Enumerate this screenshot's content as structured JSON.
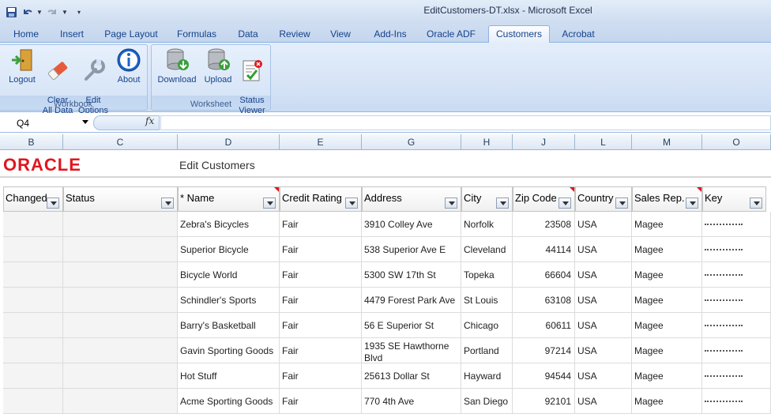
{
  "window": {
    "title": "EditCustomers-DT.xlsx - Microsoft Excel"
  },
  "ribbon_tabs": [
    {
      "label": "Home"
    },
    {
      "label": "Insert"
    },
    {
      "label": "Page Layout"
    },
    {
      "label": "Formulas"
    },
    {
      "label": "Data"
    },
    {
      "label": "Review"
    },
    {
      "label": "View"
    },
    {
      "label": "Add-Ins"
    },
    {
      "label": "Oracle ADF"
    },
    {
      "label": "Customers"
    },
    {
      "label": "Acrobat"
    }
  ],
  "active_tab": "Customers",
  "groups": {
    "workbook": {
      "label": "Workbook",
      "buttons": [
        {
          "label": "Logout",
          "icon": "logout-door-icon"
        },
        {
          "label": "Clear\nAll Data",
          "icon": "eraser-icon"
        },
        {
          "label": "Edit\nOptions",
          "icon": "wrench-icon"
        },
        {
          "label": "About",
          "icon": "info-icon"
        }
      ]
    },
    "worksheet": {
      "label": "Worksheet",
      "buttons": [
        {
          "label": "Download",
          "icon": "database-download-icon"
        },
        {
          "label": "Upload",
          "icon": "database-upload-icon"
        },
        {
          "label": "Status\nViewer",
          "icon": "status-viewer-icon"
        }
      ]
    }
  },
  "formula_bar": {
    "name_box": "Q4",
    "fx": "fx",
    "formula": ""
  },
  "columns": [
    "B",
    "C",
    "D",
    "E",
    "G",
    "H",
    "J",
    "L",
    "M",
    "O"
  ],
  "sheet": {
    "logo_text": "ORACLE",
    "title": "Edit Customers",
    "headers": [
      "Changed",
      "Status",
      "* Name",
      "Credit Rating",
      "Address",
      "City",
      "Zip Code",
      "Country",
      "Sales Rep.",
      "Key"
    ],
    "rows": [
      [
        "",
        "",
        "Zebra's Bicycles",
        "Fair",
        "3910 Colley Ave",
        "Norfolk",
        "23508",
        "USA",
        "Magee",
        ""
      ],
      [
        "",
        "",
        "Superior Bicycle",
        "Fair",
        "538 Superior Ave E",
        "Cleveland",
        "44114",
        "USA",
        "Magee",
        ""
      ],
      [
        "",
        "",
        "Bicycle World",
        "Fair",
        "5300 SW 17th St",
        "Topeka",
        "66604",
        "USA",
        "Magee",
        ""
      ],
      [
        "",
        "",
        "Schindler's Sports",
        "Fair",
        "4479 Forest Park Ave",
        "St Louis",
        "63108",
        "USA",
        "Magee",
        ""
      ],
      [
        "",
        "",
        "Barry's Basketball",
        "Fair",
        "56 E Superior St",
        "Chicago",
        "60611",
        "USA",
        "Magee",
        ""
      ],
      [
        "",
        "",
        "Gavin Sporting Goods",
        "Fair",
        "1935 SE Hawthorne Blvd",
        "Portland",
        "97214",
        "USA",
        "Magee",
        ""
      ],
      [
        "",
        "",
        "Hot Stuff",
        "Fair",
        "25613 Dollar St",
        "Hayward",
        "94544",
        "USA",
        "Magee",
        ""
      ],
      [
        "",
        "",
        "Acme Sporting Goods",
        "Fair",
        "770 4th Ave",
        "San Diego",
        "92101",
        "USA",
        "Magee",
        ""
      ]
    ]
  },
  "colors": {
    "oracle_red": "#e0161e",
    "ribbon_text": "#15428b"
  }
}
